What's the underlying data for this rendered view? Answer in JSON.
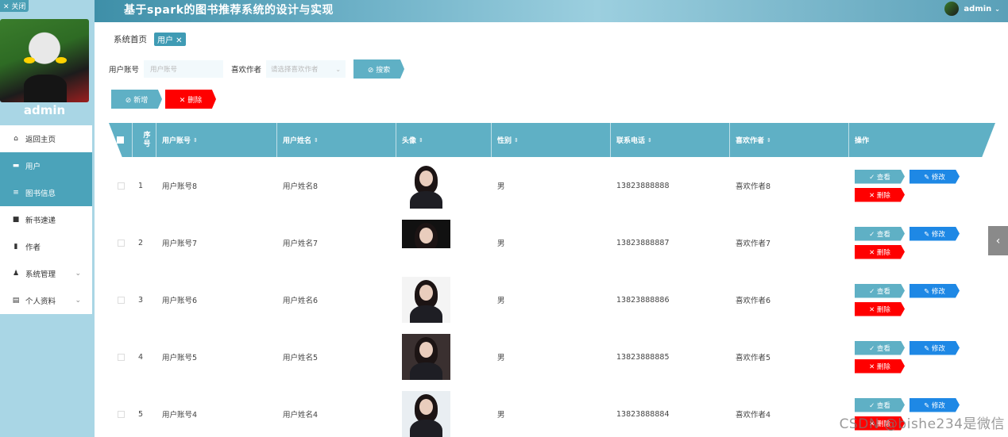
{
  "sidebar": {
    "close_label": "✕ 关闭",
    "user_name": "admin",
    "menu": [
      {
        "label": "返回主页",
        "icon": "home-icon",
        "glyph": "⌂",
        "active": false,
        "expandable": false
      },
      {
        "label": "用户",
        "icon": "user-card-icon",
        "glyph": "▬",
        "active": true,
        "expandable": false
      },
      {
        "label": "图书信息",
        "icon": "list-icon",
        "glyph": "≡",
        "active": true,
        "expandable": false
      },
      {
        "label": "新书速递",
        "icon": "check-box-icon",
        "glyph": "■",
        "active": false,
        "expandable": false
      },
      {
        "label": "作者",
        "icon": "document-icon",
        "glyph": "▮",
        "active": false,
        "expandable": false
      },
      {
        "label": "系统管理",
        "icon": "person-icon",
        "glyph": "♟",
        "active": false,
        "expandable": true
      },
      {
        "label": "个人资料",
        "icon": "profile-icon",
        "glyph": "▤",
        "active": false,
        "expandable": true
      }
    ]
  },
  "header": {
    "title": "基于spark的图书推荐系统的设计与实现",
    "user": "admin",
    "user_dropdown_icon": "chevron-down-icon"
  },
  "breadcrumb": {
    "home": "系统首页",
    "current": "用户 ✕"
  },
  "search": {
    "account_label": "用户账号",
    "account_placeholder": "用户账号",
    "author_label": "喜欢作者",
    "author_placeholder": "请选择喜欢作者",
    "search_button": "⊘ 搜索"
  },
  "toolbar": {
    "add_button": "⊘ 新增",
    "delete_button": "✕ 删除"
  },
  "table": {
    "columns": [
      "序号",
      "用户账号",
      "用户姓名",
      "头像",
      "性别",
      "联系电话",
      "喜欢作者",
      "操作"
    ],
    "sort_glyph": "⇕",
    "rows": [
      {
        "index": "1",
        "account": "用户账号8",
        "name": "用户姓名8",
        "gender": "男",
        "phone": "13823888888",
        "author": "喜欢作者8"
      },
      {
        "index": "2",
        "account": "用户账号7",
        "name": "用户姓名7",
        "gender": "男",
        "phone": "13823888887",
        "author": "喜欢作者7"
      },
      {
        "index": "3",
        "account": "用户账号6",
        "name": "用户姓名6",
        "gender": "男",
        "phone": "13823888886",
        "author": "喜欢作者6"
      },
      {
        "index": "4",
        "account": "用户账号5",
        "name": "用户姓名5",
        "gender": "男",
        "phone": "13823888885",
        "author": "喜欢作者5"
      },
      {
        "index": "5",
        "account": "用户账号4",
        "name": "用户姓名4",
        "gender": "男",
        "phone": "13823888884",
        "author": "喜欢作者4"
      }
    ],
    "row_actions": {
      "view": "✓ 查看",
      "edit": "✎ 修改",
      "delete": "✕ 删除"
    }
  },
  "side_tab": "‹",
  "watermark": "CSDN @bishe234是微信",
  "colors": {
    "accent": "#5fb0c5",
    "sidebar_bg": "#a9d6e5",
    "active_menu": "#4ba3ba",
    "edit": "#1e88e5",
    "danger": "#ff0000"
  }
}
